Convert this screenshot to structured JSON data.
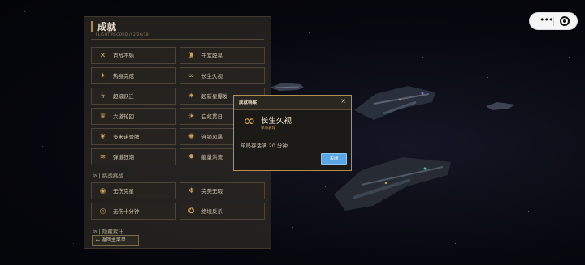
{
  "panel": {
    "title": "成就",
    "subtitle": "FLIGHT RECORD // 2/26/18",
    "achievements_top": [
      {
        "label": "百战不殆",
        "icon": "crossed-swords-icon",
        "glyph": "✕"
      },
      {
        "label": "千军辟易",
        "icon": "fleet-icon",
        "glyph": "♜"
      },
      {
        "label": "热身完成",
        "icon": "flame-icon",
        "glyph": "✦"
      },
      {
        "label": "长生久视",
        "icon": "infinity-icon",
        "glyph": "∞"
      },
      {
        "label": "超级跃迁",
        "icon": "lightning-icon",
        "glyph": "ϟ"
      },
      {
        "label": "超新星爆发",
        "icon": "star-burst-icon",
        "glyph": "✷"
      },
      {
        "label": "六道轮回",
        "icon": "crown-icon",
        "glyph": "♛"
      },
      {
        "label": "白虹贯日",
        "icon": "sun-icon",
        "glyph": "☀"
      },
      {
        "label": "多米诺骨牌",
        "icon": "wings-icon",
        "glyph": "❦"
      },
      {
        "label": "连锁风暴",
        "icon": "storm-icon",
        "glyph": "✺"
      },
      {
        "label": "弹道狂潮",
        "icon": "wave-icon",
        "glyph": "≋"
      },
      {
        "label": "能量洪流",
        "icon": "energy-icon",
        "glyph": "✹"
      }
    ],
    "section_challenge": "⊘ | 挑战挑战",
    "achievements_challenge": [
      {
        "label": "无伤克星",
        "icon": "shield-icon",
        "glyph": "◉"
      },
      {
        "label": "完美无瑕",
        "icon": "diamond-icon",
        "glyph": "❖"
      },
      {
        "label": "无伤十分钟",
        "icon": "clock-icon",
        "glyph": "◎"
      },
      {
        "label": "绝境反杀",
        "icon": "skull-icon",
        "glyph": "✪"
      }
    ],
    "section_stats": "⊘ | 隐藏累计",
    "back_label": "← 返回主菜单"
  },
  "modal": {
    "title": "成就档案",
    "close": "×",
    "name": "长生久视",
    "rarity": "单局表现",
    "icon": "infinity-icon",
    "glyph": "∞",
    "description": "单局存活满 20 分钟",
    "ok_label": "关闭"
  },
  "capsule": {
    "more": "•••"
  },
  "colors": {
    "accent": "#c9a35e",
    "button": "#5aa6e4",
    "modal_border": "#b08f52"
  }
}
